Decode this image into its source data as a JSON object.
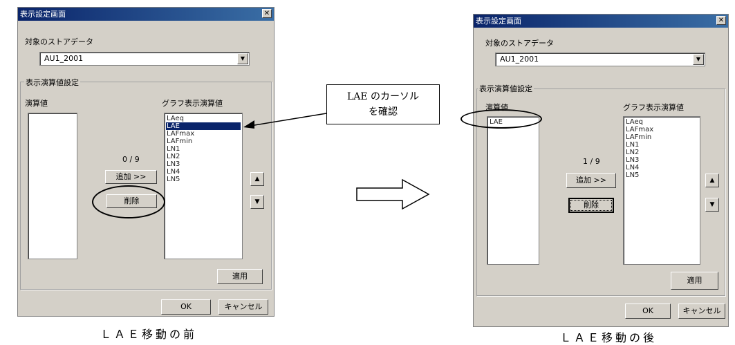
{
  "before": {
    "title": "表示設定画面",
    "close_glyph": "✕",
    "store_label": "対象のストアデータ",
    "store_value": "AU1_2001",
    "group_title": "表示演算値設定",
    "left_list_label": "演算値",
    "right_list_label": "グラフ表示演算値",
    "left_items": [],
    "right_items": [
      "LAeq",
      "LAE",
      "LAFmax",
      "LAFmin",
      "LN1",
      "LN2",
      "LN3",
      "LN4",
      "LN5"
    ],
    "selected_item": "LAE",
    "count": "0 / 9",
    "add_label": "追加 >>",
    "delete_label": "削除",
    "apply_label": "適用",
    "ok_label": "OK",
    "cancel_label": "キャンセル",
    "up_glyph": "▲",
    "down_glyph": "▼",
    "caption": "ＬＡＥ移動の前"
  },
  "after": {
    "title": "表示設定画面",
    "close_glyph": "✕",
    "store_label": "対象のストアデータ",
    "store_value": "AU1_2001",
    "group_title": "表示演算値設定",
    "left_list_label": "演算値",
    "right_list_label": "グラフ表示演算値",
    "left_items": [
      "LAE"
    ],
    "right_items": [
      "LAeq",
      "LAFmax",
      "LAFmin",
      "LN1",
      "LN2",
      "LN3",
      "LN4",
      "LN5"
    ],
    "count": "1 / 9",
    "add_label": "追加 >>",
    "delete_label": "削除",
    "apply_label": "適用",
    "ok_label": "OK",
    "cancel_label": "キャンセル",
    "up_glyph": "▲",
    "down_glyph": "▼",
    "caption": "ＬＡＥ移動の後"
  },
  "callout": {
    "line1": "LAE のカーソル",
    "line2": "を確認"
  },
  "colors": {
    "dialog_bg": "#d4d0c8",
    "title_bar": "#0a246a",
    "selection": "#0a246a"
  },
  "icons": {
    "combo_arrow": "chevron-down-icon",
    "transition_arrow": "right-arrow-icon",
    "callout_pointer": "arrow-pointer-icon"
  }
}
